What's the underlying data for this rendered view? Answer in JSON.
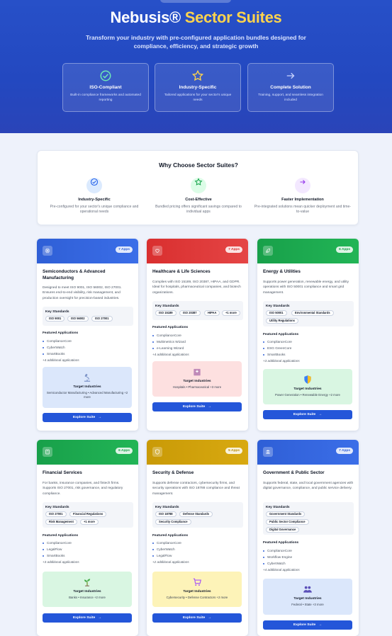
{
  "hero": {
    "title_main": "Nebusis®",
    "title_accent": "Sector Suites",
    "subtitle": "Transform your industry with pre-configured application bundles designed for compliance, efficiency, and strategic growth",
    "features": [
      {
        "icon": "check-circle-icon",
        "title": "ISO-Compliant",
        "desc": "Built-in compliance frameworks and automated reporting"
      },
      {
        "icon": "star-icon",
        "title": "Industry-Specific",
        "desc": "Tailored applications for your sector's unique needs"
      },
      {
        "icon": "arrow-right-icon",
        "title": "Complete Solution",
        "desc": "Training, support, and seamless integration included"
      }
    ]
  },
  "why": {
    "title": "Why Choose Sector Suites?",
    "items": [
      {
        "icon": "check-circle-icon",
        "color": "#dbeafe",
        "name": "Industry-Specific",
        "desc": "Pre-configured for your sector's unique compliance and operational needs"
      },
      {
        "icon": "star-icon",
        "color": "#dcfce7",
        "name": "Cost-Effective",
        "desc": "Bundled pricing offers significant savings compared to individual apps"
      },
      {
        "icon": "arrow-right-icon",
        "color": "#f3e8ff",
        "name": "Faster Implementation",
        "desc": "Pre-integrated solutions mean quicker deployment and time-to-value"
      }
    ]
  },
  "cards": [
    {
      "name": "Semiconductors & Advanced Manufacturing",
      "apps": "7 Apps",
      "head_color": "#2f5fd6",
      "icon": "chip-icon",
      "desc": "Designed to meet ISO 9001, ISO 56002, ISO 27001. Ensures end-to-end visibility, risk management, and production oversight for precision-based industries.",
      "standards_label": "Key Standards",
      "standards": [
        "ISO 9001",
        "ISO 56002",
        "ISO 27001"
      ],
      "featured_label": "Featured Applications",
      "featured": [
        "ComplianceCore",
        "CyberWatch",
        "SmartBooks"
      ],
      "more": "+4 additional applications",
      "target_label": "Target Industries",
      "target_icon": "microscope-icon",
      "target_bg": "#dbe7fb",
      "target_desc": "Semiconductor Manufacturing • Advanced Manufacturing +2 more",
      "button": "Explore Suite"
    },
    {
      "name": "Healthcare & Life Sciences",
      "apps": "7 Apps",
      "head_color": "#d92f2f",
      "icon": "heart-icon",
      "desc": "Complies with ISO 15189, ISO 20387, HIPAA, and GDPR. Ideal for hospitals, pharmaceutical companies, and biotech organizations.",
      "standards_label": "Key Standards",
      "standards": [
        "ISO 15189",
        "ISO 20387",
        "HIPAA",
        "+1 more"
      ],
      "featured_label": "Featured Applications",
      "featured": [
        "ComplianceCore",
        "Multimetrics Wizard",
        "e-Learning Wizard"
      ],
      "more": "+4 additional applications",
      "target_label": "Target Industries",
      "target_icon": "hospital-icon",
      "target_bg": "#fde0e0",
      "target_desc": "Hospitals • Pharmaceutical +3 more",
      "button": "Explore Suite"
    },
    {
      "name": "Energy & Utilities",
      "apps": "6 Apps",
      "head_color": "#18a04a",
      "icon": "leaf-icon",
      "desc": "Supports power generation, renewable energy, and utility operations with ISO 50001 compliance and smart grid management.",
      "standards_label": "Key Standards",
      "standards": [
        "ISO 50001",
        "Environmental Standards",
        "Utility Regulations"
      ],
      "featured_label": "Featured Applications",
      "featured": [
        "ComplianceCore",
        "ESG GreenCore",
        "SmartBooks"
      ],
      "more": "+3 additional applications",
      "target_label": "Target Industries",
      "target_icon": "shield-icon",
      "target_bg": "#d9f6e2",
      "target_desc": "Power Generation • Renewable Energy +2 more",
      "button": "Explore Suite"
    },
    {
      "name": "Financial Services",
      "apps": "6 Apps",
      "head_color": "#18a04a",
      "icon": "calculator-icon",
      "desc": "For banks, insurance companies, and fintech firms. Supports ISO 27001, risk governance, and regulatory compliance.",
      "standards_label": "Key Standards",
      "standards": [
        "ISO 27001",
        "Financial Regulations",
        "Risk Management",
        "+1 more"
      ],
      "featured_label": "Featured Applications",
      "featured": [
        "ComplianceCore",
        "LegalFlow",
        "SmartBooks"
      ],
      "more": "+3 additional applications",
      "target_label": "Target Industries",
      "target_icon": "plant-icon",
      "target_bg": "#d9f6e2",
      "target_desc": "Banks • Insurance +2 more",
      "button": "Explore Suite"
    },
    {
      "name": "Security & Defense",
      "apps": "5 Apps",
      "head_color": "#c99a07",
      "icon": "shield-icon",
      "desc": "Supports defense contractors, cybersecurity firms, and security operations with ISO 18788 compliance and threat management.",
      "standards_label": "Key Standards",
      "standards": [
        "ISO 18788",
        "Defense Standards",
        "Security Compliance"
      ],
      "featured_label": "Featured Applications",
      "featured": [
        "ComplianceCore",
        "CyberWatch",
        "LegalFlow"
      ],
      "more": "+2 additional applications",
      "target_label": "Target Industries",
      "target_icon": "cart-icon",
      "target_bg": "#fdf3b8",
      "target_desc": "Cybersecurity • Defense Contractors +2 more",
      "button": "Explore Suite"
    },
    {
      "name": "Government & Public Sector",
      "apps": "7 Apps",
      "head_color": "#2f5fd6",
      "icon": "bank-icon",
      "desc": "Supports federal, state, and local government agencies with digital governance, compliance, and public service delivery.",
      "standards_label": "Key Standards",
      "standards": [
        "Government Standards",
        "Public Sector Compliance",
        "Digital Governance"
      ],
      "featured_label": "Featured Applications",
      "featured": [
        "ComplianceCore",
        "Workflow Engine",
        "CyberWatch"
      ],
      "more": "+4 additional applications",
      "target_label": "Target Industries",
      "target_icon": "people-icon",
      "target_bg": "#dbe7fb",
      "target_desc": "Federal • State +3 more",
      "button": "Explore Suite"
    }
  ]
}
